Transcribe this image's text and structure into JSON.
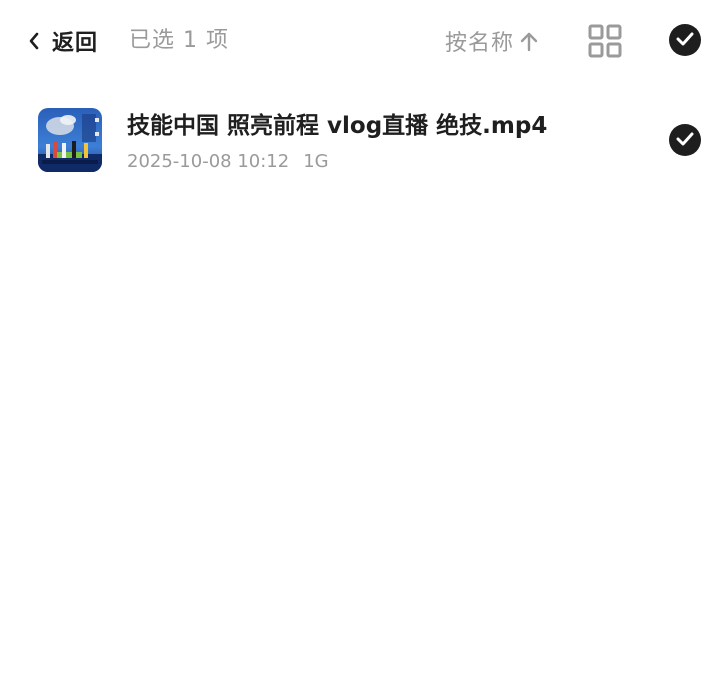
{
  "header": {
    "back_label": "返回",
    "selected_text": "已选 1 项",
    "sort_label": "按名称"
  },
  "icons": {
    "back": "chevron-left-icon",
    "sort_direction": "arrow-up-icon",
    "view_toggle": "grid-view-icon",
    "select_all": "check-circle-icon",
    "row_check": "check-circle-icon"
  },
  "colors": {
    "primary_text": "#1f1f1f",
    "secondary_text": "#9a9a9a",
    "check_fill": "#1e1e1e",
    "background": "#ffffff"
  },
  "files": [
    {
      "name": "技能中国 照亮前程 vlog直播 绝技.mp4",
      "date": "2025-10-08 10:12",
      "size": "1G",
      "selected": true
    }
  ]
}
